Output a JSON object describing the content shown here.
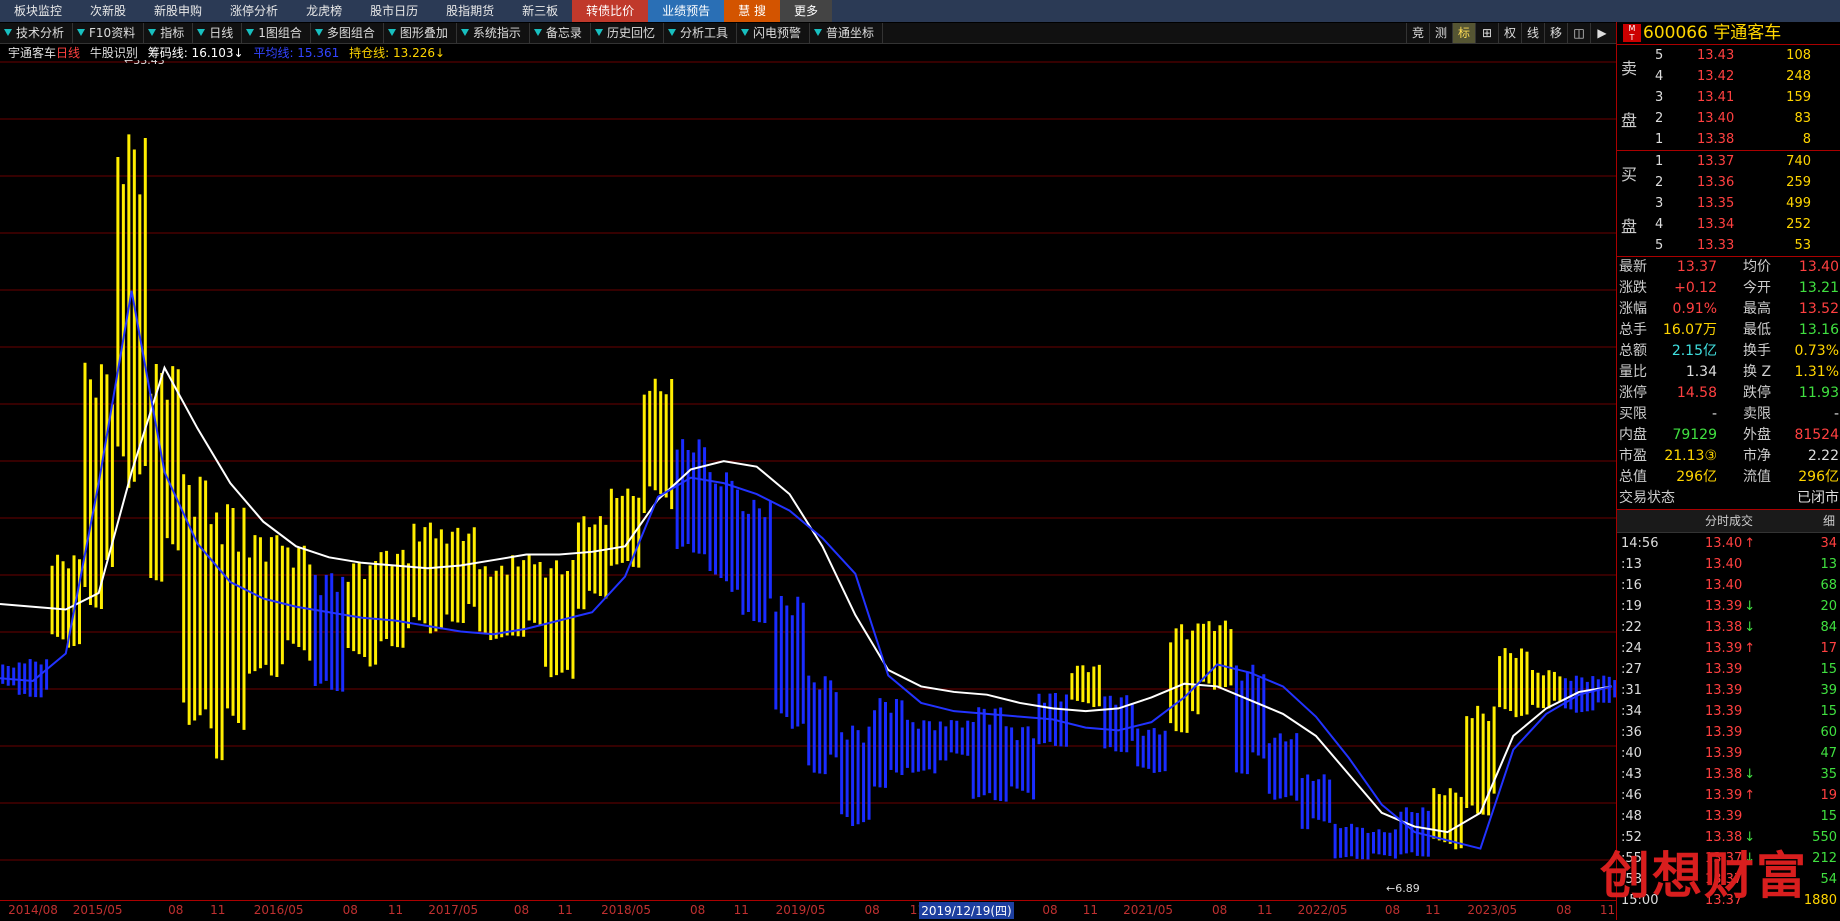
{
  "topnav": [
    "板块监控",
    "次新股",
    "新股申购",
    "涨停分析",
    "龙虎榜",
    "股市日历",
    "股指期货",
    "新三板",
    "转债比价",
    "业绩预告",
    "慧 搜",
    "更多"
  ],
  "toolbar": [
    "技术分析",
    "F10资料",
    "指标",
    "日线",
    "1图组合",
    "多图组合",
    "图形叠加",
    "系统指示",
    "备忘录",
    "历史回忆",
    "分析工具",
    "闪电预警",
    "普通坐标"
  ],
  "toolbar_right": [
    "竞",
    "测",
    "标",
    "⊞",
    "权",
    "线",
    "移",
    "◫",
    "▶"
  ],
  "legend": {
    "name": "宇通客车",
    "period": "日线",
    "indicator": "牛股识别",
    "line1": "筹码线: 16.103↓",
    "line2": "平均线: 15.361",
    "line3": "持仓线: 13.226↓"
  },
  "annotations": {
    "high": "←33.43",
    "low": "←6.89"
  },
  "date_axis": {
    "ticks": [
      {
        "label": "2014/08",
        "pos": 0.005
      },
      {
        "label": "2015/05",
        "pos": 0.045
      },
      {
        "label": "08",
        "pos": 0.104
      },
      {
        "label": "11",
        "pos": 0.13
      },
      {
        "label": "2016/05",
        "pos": 0.157
      },
      {
        "label": "08",
        "pos": 0.212
      },
      {
        "label": "11",
        "pos": 0.24
      },
      {
        "label": "2017/05",
        "pos": 0.265
      },
      {
        "label": "08",
        "pos": 0.318
      },
      {
        "label": "11",
        "pos": 0.345
      },
      {
        "label": "2018/05",
        "pos": 0.372
      },
      {
        "label": "08",
        "pos": 0.427
      },
      {
        "label": "11",
        "pos": 0.454
      },
      {
        "label": "2019/05",
        "pos": 0.48
      },
      {
        "label": "08",
        "pos": 0.535
      },
      {
        "label": "11",
        "pos": 0.563
      },
      {
        "label": "08",
        "pos": 0.645
      },
      {
        "label": "11",
        "pos": 0.67
      },
      {
        "label": "2021/05",
        "pos": 0.695
      },
      {
        "label": "08",
        "pos": 0.75
      },
      {
        "label": "11",
        "pos": 0.778
      },
      {
        "label": "2022/05",
        "pos": 0.803
      },
      {
        "label": "08",
        "pos": 0.857
      },
      {
        "label": "11",
        "pos": 0.882
      },
      {
        "label": "2023/05",
        "pos": 0.908
      },
      {
        "label": "08",
        "pos": 0.963
      },
      {
        "label": "11",
        "pos": 0.99
      }
    ],
    "cursor": {
      "label": "2019/12/19(四)",
      "pos": 0.575
    }
  },
  "stock": {
    "code": "600066",
    "name": "宇通客车"
  },
  "order_book": {
    "sell_label_1": "卖",
    "sell_label_2": "盘",
    "buy_label_1": "买",
    "buy_label_2": "盘",
    "sell": [
      {
        "lvl": "5",
        "price": "13.43",
        "vol": "108"
      },
      {
        "lvl": "4",
        "price": "13.42",
        "vol": "248"
      },
      {
        "lvl": "3",
        "price": "13.41",
        "vol": "159"
      },
      {
        "lvl": "2",
        "price": "13.40",
        "vol": "83"
      },
      {
        "lvl": "1",
        "price": "13.38",
        "vol": "8"
      }
    ],
    "buy": [
      {
        "lvl": "1",
        "price": "13.37",
        "vol": "740"
      },
      {
        "lvl": "2",
        "price": "13.36",
        "vol": "259"
      },
      {
        "lvl": "3",
        "price": "13.35",
        "vol": "499"
      },
      {
        "lvl": "4",
        "price": "13.34",
        "vol": "252"
      },
      {
        "lvl": "5",
        "price": "13.33",
        "vol": "53"
      }
    ]
  },
  "quote": [
    {
      "l1": "最新",
      "v1": "13.37",
      "c1": "red",
      "l2": "均价",
      "v2": "13.40",
      "c2": "red"
    },
    {
      "l1": "涨跌",
      "v1": "+0.12",
      "c1": "red",
      "l2": "今开",
      "v2": "13.21",
      "c2": "green"
    },
    {
      "l1": "涨幅",
      "v1": "0.91%",
      "c1": "red",
      "l2": "最高",
      "v2": "13.52",
      "c2": "red"
    },
    {
      "l1": "总手",
      "v1": "16.07万",
      "c1": "yellow",
      "l2": "最低",
      "v2": "13.16",
      "c2": "green"
    },
    {
      "l1": "总额",
      "v1": "2.15亿",
      "c1": "cyan",
      "l2": "换手",
      "v2": "0.73%",
      "c2": "yellow"
    },
    {
      "l1": "量比",
      "v1": "1.34",
      "c1": "white",
      "l2": "换 Z",
      "v2": "1.31%",
      "c2": "yellow"
    },
    {
      "l1": "涨停",
      "v1": "14.58",
      "c1": "red",
      "l2": "跌停",
      "v2": "11.93",
      "c2": "green"
    },
    {
      "l1": "买限",
      "v1": "-",
      "c1": "white",
      "l2": "卖限",
      "v2": "-",
      "c2": "white"
    },
    {
      "l1": "内盘",
      "v1": "79129",
      "c1": "green",
      "l2": "外盘",
      "v2": "81524",
      "c2": "red"
    },
    {
      "l1": "市盈",
      "v1": "21.13③",
      "c1": "yellow",
      "l2": "市净",
      "v2": "2.22",
      "c2": "white"
    },
    {
      "l1": "总值",
      "v1": "296亿",
      "c1": "yellow",
      "l2": "流值",
      "v2": "296亿",
      "c2": "yellow"
    },
    {
      "l1": "交易状态",
      "v1": "",
      "c1": "white",
      "l2": "",
      "v2": "已闭市",
      "c2": "white"
    }
  ],
  "ticks_head": {
    "title": "分时成交",
    "detail": "细"
  },
  "ticks": [
    {
      "t": "14:56",
      "p": "13.40",
      "d": "↑",
      "pc": "red",
      "v": "34",
      "vc": "red"
    },
    {
      "t": ":13",
      "p": "13.40",
      "d": "",
      "pc": "red",
      "v": "13",
      "vc": "green"
    },
    {
      "t": ":16",
      "p": "13.40",
      "d": "",
      "pc": "red",
      "v": "68",
      "vc": "green"
    },
    {
      "t": ":19",
      "p": "13.39",
      "d": "↓",
      "pc": "red",
      "v": "20",
      "vc": "green"
    },
    {
      "t": ":22",
      "p": "13.38",
      "d": "↓",
      "pc": "red",
      "v": "84",
      "vc": "green"
    },
    {
      "t": ":24",
      "p": "13.39",
      "d": "↑",
      "pc": "red",
      "v": "17",
      "vc": "red"
    },
    {
      "t": ":27",
      "p": "13.39",
      "d": "",
      "pc": "red",
      "v": "15",
      "vc": "green"
    },
    {
      "t": ":31",
      "p": "13.39",
      "d": "",
      "pc": "red",
      "v": "39",
      "vc": "green"
    },
    {
      "t": ":34",
      "p": "13.39",
      "d": "",
      "pc": "red",
      "v": "15",
      "vc": "green"
    },
    {
      "t": ":36",
      "p": "13.39",
      "d": "",
      "pc": "red",
      "v": "60",
      "vc": "green"
    },
    {
      "t": ":40",
      "p": "13.39",
      "d": "",
      "pc": "red",
      "v": "47",
      "vc": "green"
    },
    {
      "t": ":43",
      "p": "13.38",
      "d": "↓",
      "pc": "red",
      "v": "35",
      "vc": "green"
    },
    {
      "t": ":46",
      "p": "13.39",
      "d": "↑",
      "pc": "red",
      "v": "19",
      "vc": "red"
    },
    {
      "t": ":48",
      "p": "13.39",
      "d": "",
      "pc": "red",
      "v": "15",
      "vc": "green"
    },
    {
      "t": ":52",
      "p": "13.38",
      "d": "↓",
      "pc": "red",
      "v": "550",
      "vc": "green"
    },
    {
      "t": ":55",
      "p": "13.37",
      "d": "↓",
      "pc": "red",
      "v": "212",
      "vc": "green"
    },
    {
      "t": ":58",
      "p": "13.37",
      "d": "",
      "pc": "red",
      "v": "54",
      "vc": "green"
    },
    {
      "t": "15:00",
      "p": "13.37",
      "d": "",
      "pc": "red",
      "v": "1880",
      "vc": "yellow"
    }
  ],
  "watermark": "创想财富",
  "chart_data": {
    "type": "line",
    "series": [
      {
        "name": "筹码线",
        "color": "#ffffff",
        "values": [
          16.2,
          16.1,
          16.0,
          16.6,
          21.0,
          24.8,
          22.6,
          20.6,
          19.2,
          18.3,
          17.9,
          17.7,
          17.6,
          17.5,
          17.6,
          17.8,
          18.0,
          18.0,
          18.1,
          18.3,
          20.0,
          21.1,
          21.4,
          21.2,
          20.2,
          18.3,
          15.8,
          13.8,
          13.2,
          13.0,
          12.9,
          12.6,
          12.4,
          12.3,
          12.4,
          12.8,
          13.3,
          13.2,
          12.7,
          12.2,
          11.4,
          10.0,
          8.6,
          8.1,
          7.9,
          8.6,
          11.4,
          12.4,
          13.0,
          13.2
        ]
      },
      {
        "name": "平均线",
        "color": "#2233ff",
        "values": [
          13.5,
          13.4,
          14.4,
          20.6,
          27.6,
          21.0,
          18.4,
          17.0,
          16.4,
          16.1,
          15.9,
          15.7,
          15.6,
          15.4,
          15.2,
          15.1,
          15.3,
          15.6,
          15.9,
          17.2,
          20.1,
          20.8,
          20.6,
          20.2,
          19.6,
          18.6,
          17.3,
          13.6,
          12.6,
          12.3,
          12.2,
          12.1,
          12.0,
          11.7,
          11.6,
          11.9,
          12.8,
          14.0,
          13.7,
          13.2,
          12.1,
          10.6,
          8.9,
          7.9,
          7.6,
          7.3,
          10.9,
          12.2,
          12.9,
          13.2
        ]
      }
    ],
    "candles_hl": [
      [
        13.2,
        14.0
      ],
      [
        12.8,
        14.2
      ],
      [
        14.5,
        18.0
      ],
      [
        16.0,
        25.0
      ],
      [
        20.0,
        33.4
      ],
      [
        17.0,
        25.0
      ],
      [
        11.5,
        21.0
      ],
      [
        10.5,
        20.0
      ],
      [
        13.5,
        18.8
      ],
      [
        14.0,
        18.4
      ],
      [
        13.0,
        17.4
      ],
      [
        13.8,
        17.8
      ],
      [
        14.6,
        18.2
      ],
      [
        15.0,
        19.2
      ],
      [
        15.5,
        19.0
      ],
      [
        14.8,
        17.6
      ],
      [
        15.0,
        18.0
      ],
      [
        13.4,
        17.8
      ],
      [
        16.0,
        19.4
      ],
      [
        17.5,
        20.4
      ],
      [
        19.5,
        24.4
      ],
      [
        18.0,
        22.2
      ],
      [
        16.5,
        21.0
      ],
      [
        15.5,
        20.0
      ],
      [
        11.5,
        16.5
      ],
      [
        10.0,
        13.6
      ],
      [
        8.0,
        11.8
      ],
      [
        9.5,
        12.8
      ],
      [
        10.0,
        12.0
      ],
      [
        10.5,
        12.0
      ],
      [
        9.0,
        12.5
      ],
      [
        9.0,
        11.8
      ],
      [
        11.0,
        13.0
      ],
      [
        12.4,
        14.0
      ],
      [
        10.8,
        12.9
      ],
      [
        10.0,
        11.7
      ],
      [
        11.5,
        15.5
      ],
      [
        13.0,
        15.6
      ],
      [
        10.0,
        14.0
      ],
      [
        9.0,
        11.5
      ],
      [
        8.0,
        10.0
      ],
      [
        6.9,
        8.2
      ],
      [
        6.9,
        8.0
      ],
      [
        7.0,
        8.8
      ],
      [
        7.2,
        9.5
      ],
      [
        8.5,
        12.5
      ],
      [
        12.0,
        14.6
      ],
      [
        12.4,
        13.8
      ],
      [
        12.2,
        13.6
      ],
      [
        12.6,
        13.6
      ]
    ],
    "ylim": [
      5.5,
      36
    ],
    "x_start": "2014/08",
    "x_end": "2023/11"
  }
}
